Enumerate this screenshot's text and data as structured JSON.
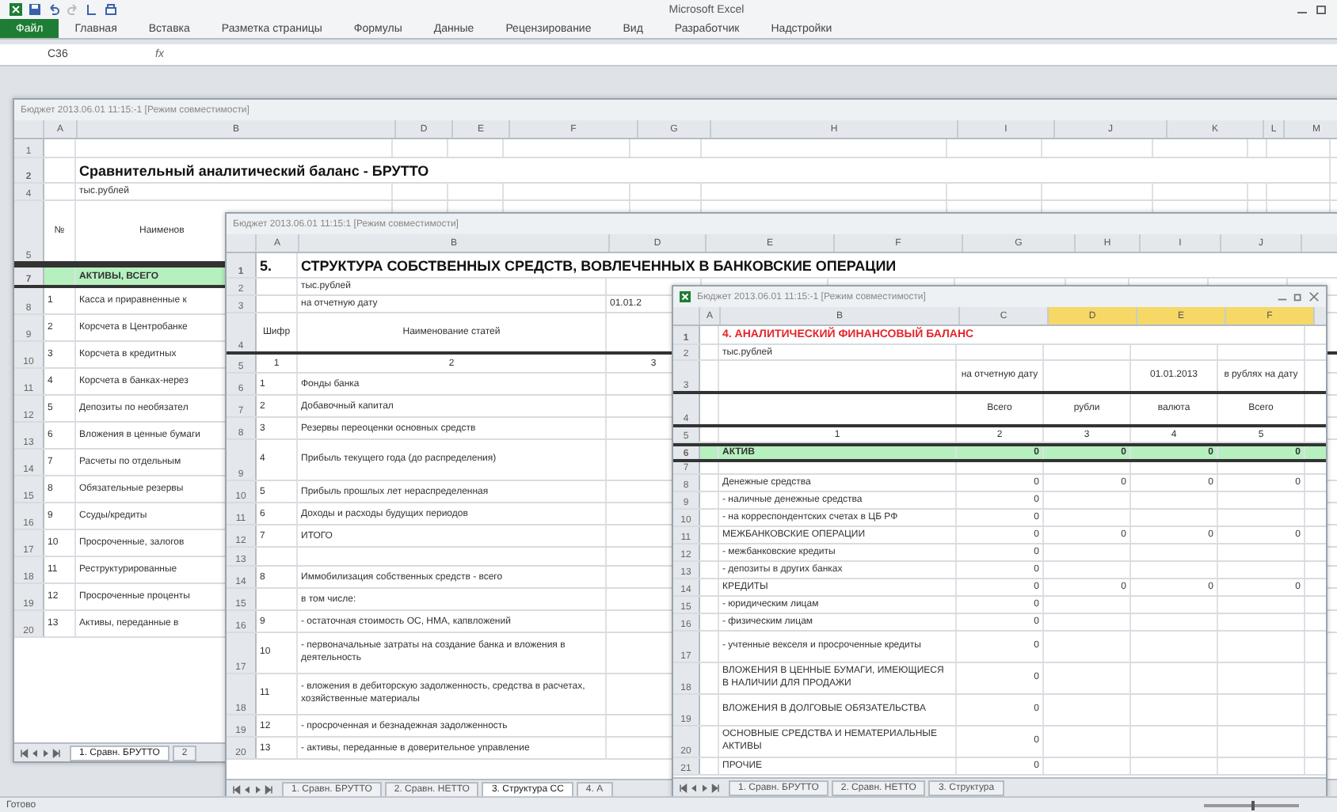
{
  "app": {
    "title": "Microsoft Excel"
  },
  "ribbon_tabs": [
    {
      "label": "Файл",
      "selected": true
    },
    {
      "label": "Главная",
      "selected": false
    },
    {
      "label": "Вставка",
      "selected": false
    },
    {
      "label": "Разметка страницы",
      "selected": false
    },
    {
      "label": "Формулы",
      "selected": false
    },
    {
      "label": "Данные",
      "selected": false
    },
    {
      "label": "Рецензирование",
      "selected": false
    },
    {
      "label": "Вид",
      "selected": false
    },
    {
      "label": "Разработчик",
      "selected": false
    },
    {
      "label": "Надстройки",
      "selected": false
    }
  ],
  "formula_bar": {
    "cell": "C36",
    "fx": "fx"
  },
  "windows": [
    {
      "title": "Бюджет 2013.06.01 11:15:-1 [Режим совместимости]",
      "columns": [
        "A",
        "B",
        "D",
        "E",
        "F",
        "G",
        "H",
        "I",
        "J",
        "K",
        "L",
        "M"
      ],
      "rows": [
        {
          "number": "1",
          "kind": "blank"
        },
        {
          "number": "2",
          "kind": "title",
          "cells": [
            null,
            "Сравнительный аналитический баланс - БРУТТО"
          ]
        },
        {
          "number": "4",
          "kind": "units",
          "cells": [
            null,
            "тыс.рублей"
          ]
        },
        {
          "number": "5",
          "kind": "header",
          "cells": [
            "№",
            "Наименов"
          ]
        },
        {
          "number": "7",
          "kind": "green",
          "cells": [
            null,
            "АКТИВЫ, ВСЕГО"
          ]
        },
        {
          "number": "8",
          "kind": "item",
          "cells": [
            "1",
            "Касса и приравненные к"
          ]
        },
        {
          "number": "9",
          "kind": "item",
          "cells": [
            "2",
            "Корсчета в Центробанке"
          ]
        },
        {
          "number": "10",
          "kind": "item",
          "cells": [
            "3",
            "Корсчета в кредитных"
          ]
        },
        {
          "number": "11",
          "kind": "item",
          "cells": [
            "4",
            "Корсчета в банках-нерез"
          ]
        },
        {
          "number": "12",
          "kind": "item",
          "cells": [
            "5",
            "Депозиты по необязател"
          ]
        },
        {
          "number": "13",
          "kind": "item",
          "cells": [
            "6",
            "Вложения в ценные бумаги"
          ]
        },
        {
          "number": "14",
          "kind": "item",
          "cells": [
            "7",
            "Расчеты по отдельным"
          ]
        },
        {
          "number": "15",
          "kind": "item",
          "cells": [
            "8",
            "Обязательные резервы"
          ]
        },
        {
          "number": "16",
          "kind": "item",
          "cells": [
            "9",
            "Ссуды/кредиты"
          ]
        },
        {
          "number": "17",
          "kind": "item",
          "cells": [
            "10",
            "Просроченные, залогов"
          ]
        },
        {
          "number": "18",
          "kind": "item",
          "cells": [
            "11",
            "Реструктурированные"
          ]
        },
        {
          "number": "19",
          "kind": "item",
          "cells": [
            "12",
            "Просроченные проценты"
          ]
        },
        {
          "number": "20",
          "kind": "item",
          "cells": [
            "13",
            "Активы, переданные в"
          ]
        }
      ],
      "sheet_tabs": [
        {
          "label": "1. Сравн. БРУТТО",
          "selected": true
        },
        {
          "label": "2",
          "selected": false
        }
      ]
    },
    {
      "title": "Бюджет 2013.06.01 11:15:1 [Режим совместимости]",
      "columns": [
        "A",
        "B",
        "D",
        "E",
        "F",
        "G",
        "H",
        "I",
        "J"
      ],
      "rows": [
        {
          "number": "1",
          "kind": "title",
          "cells": [
            "5.",
            "СТРУКТУРА  СОБСТВЕННЫХ  СРЕДСТВ,  ВОВЛЕЧЕННЫХ  В  БАНКОВСКИЕ  ОПЕРАЦИИ"
          ]
        },
        {
          "number": "2",
          "kind": "units",
          "cells": [
            null,
            "тыс.рублей"
          ]
        },
        {
          "number": "3",
          "kind": "units",
          "cells": [
            null,
            "на отчетную дату",
            "01.01.2"
          ]
        },
        {
          "number": "4",
          "kind": "header",
          "cells": [
            "Шифр",
            "Наименование статей"
          ]
        },
        {
          "number": "5",
          "kind": "index",
          "cells": [
            "1",
            "2",
            "3"
          ]
        },
        {
          "number": "6",
          "kind": "item",
          "cells": [
            "1",
            "Фонды банка"
          ]
        },
        {
          "number": "7",
          "kind": "item",
          "cells": [
            "2",
            "Добавочный капитал"
          ]
        },
        {
          "number": "8",
          "kind": "item",
          "cells": [
            "3",
            "Резервы переоценки основных средств"
          ]
        },
        {
          "number": "9",
          "kind": "tall",
          "cells": [
            "4",
            "Прибыль текущего года (до распределения)"
          ]
        },
        {
          "number": "10",
          "kind": "item",
          "cells": [
            "5",
            "Прибыль прошлых лет нераспределенная"
          ]
        },
        {
          "number": "11",
          "kind": "item",
          "cells": [
            "6",
            "Доходы и расходы будущих периодов"
          ]
        },
        {
          "number": "12",
          "kind": "item",
          "cells": [
            "7",
            "ИТОГО"
          ]
        },
        {
          "number": "13",
          "kind": "blank"
        },
        {
          "number": "14",
          "kind": "item",
          "cells": [
            "8",
            "Иммобилизация собственных средств - всего"
          ]
        },
        {
          "number": "15",
          "kind": "item",
          "cells": [
            null,
            "в том числе:"
          ]
        },
        {
          "number": "16",
          "kind": "item",
          "cells": [
            "9",
            "- остаточная стоимость ОС, НМА, капвложений"
          ]
        },
        {
          "number": "17",
          "kind": "tall",
          "cells": [
            "10",
            "- первоначальные затраты на создание банка и вложения в деятельность"
          ]
        },
        {
          "number": "18",
          "kind": "tall",
          "cells": [
            "11",
            "- вложения в дебиторскую задолженность, средства в расчетах, хозяйственные материалы"
          ]
        },
        {
          "number": "19",
          "kind": "item",
          "cells": [
            "12",
            "- просроченная и безнадежная задолженность"
          ]
        },
        {
          "number": "20",
          "kind": "item",
          "cells": [
            "13",
            "- активы, переданные в доверительное управление"
          ]
        }
      ],
      "sheet_tabs": [
        {
          "label": "1. Сравн. БРУТТО",
          "selected": false
        },
        {
          "label": "2. Сравн. НЕТТО",
          "selected": false
        },
        {
          "label": "3. Структура СС",
          "selected": true
        },
        {
          "label": "4. А",
          "selected": false
        }
      ]
    },
    {
      "title": "Бюджет 2013.06.01 11:15:-1 [Режим совместимости]",
      "columns": [
        "A",
        "B",
        "C",
        "D",
        "E",
        "F"
      ],
      "highlighted_columns": [
        {
          "selected": false
        },
        {
          "selected": false
        },
        {
          "selected": false
        },
        {
          "selected": true
        },
        {
          "selected": true
        },
        {
          "selected": true
        }
      ],
      "rows": [
        {
          "number": "1",
          "kind": "red-title",
          "cells": [
            "4.  АНАЛИТИЧЕСКИЙ ФИНАНСОВЫЙ БАЛАНС"
          ]
        },
        {
          "number": "2",
          "kind": "units",
          "cells": [
            "тыс.рублей"
          ]
        },
        {
          "number": "3",
          "kind": "header",
          "cells": [
            null,
            "на отчетную дату",
            null,
            "01.01.2013",
            "в рублях на дату"
          ]
        },
        {
          "number": "4",
          "kind": "header",
          "cells": [
            null,
            "Всего",
            "рубли",
            "валюта",
            "Всего"
          ]
        },
        {
          "number": "5",
          "kind": "index",
          "cells": [
            "1",
            "2",
            "3",
            "4",
            "5"
          ]
        },
        {
          "number": "6",
          "kind": "green",
          "cells": [
            "АКТИВ",
            "0",
            "0",
            "0",
            "0"
          ]
        },
        {
          "number": "7",
          "kind": "blank"
        },
        {
          "number": "8",
          "kind": "item",
          "cells": [
            "Денежные средства",
            "0",
            "0",
            "0",
            "0"
          ]
        },
        {
          "number": "9",
          "kind": "item",
          "cells": [
            "- наличные денежные средства",
            "0"
          ]
        },
        {
          "number": "10",
          "kind": "item",
          "cells": [
            "- на корреспондентских счетах в ЦБ РФ",
            "0"
          ]
        },
        {
          "number": "11",
          "kind": "item",
          "cells": [
            "МЕЖБАНКОВСКИЕ ОПЕРАЦИИ",
            "0",
            "0",
            "0",
            "0"
          ]
        },
        {
          "number": "12",
          "kind": "item",
          "cells": [
            "- межбанковские кредиты",
            "0"
          ]
        },
        {
          "number": "13",
          "kind": "item",
          "cells": [
            "- депозиты в других банках",
            "0"
          ]
        },
        {
          "number": "14",
          "kind": "item",
          "cells": [
            "КРЕДИТЫ",
            "0",
            "0",
            "0",
            "0"
          ]
        },
        {
          "number": "15",
          "kind": "item",
          "cells": [
            "- юридическим лицам",
            "0"
          ]
        },
        {
          "number": "16",
          "kind": "item",
          "cells": [
            "- физическим лицам",
            "0"
          ]
        },
        {
          "number": "17",
          "kind": "tall",
          "cells": [
            "- учтенные векселя и просроченные кредиты",
            "0"
          ]
        },
        {
          "number": "18",
          "kind": "tall",
          "cells": [
            "ВЛОЖЕНИЯ В ЦЕННЫЕ БУМАГИ, ИМЕЮЩИЕСЯ В НАЛИЧИИ ДЛЯ ПРОДАЖИ",
            "0"
          ]
        },
        {
          "number": "19",
          "kind": "tall",
          "cells": [
            "ВЛОЖЕНИЯ В ДОЛГОВЫЕ ОБЯЗАТЕЛЬСТВА",
            "0"
          ]
        },
        {
          "number": "20",
          "kind": "tall",
          "cells": [
            "ОСНОВНЫЕ СРЕДСТВА И НЕМАТЕРИАЛЬНЫЕ АКТИВЫ",
            "0"
          ]
        },
        {
          "number": "21",
          "kind": "item",
          "cells": [
            "ПРОЧИЕ",
            "0"
          ]
        }
      ],
      "sheet_tabs": [
        {
          "label": "1. Сравн. БРУТТО",
          "selected": false
        },
        {
          "label": "2. Сравн. НЕТТО",
          "selected": false
        },
        {
          "label": "3. Структура",
          "selected": false
        }
      ]
    }
  ],
  "status_bar": {
    "text": "Готово",
    "zoom": {
      "level": 0.5
    }
  }
}
